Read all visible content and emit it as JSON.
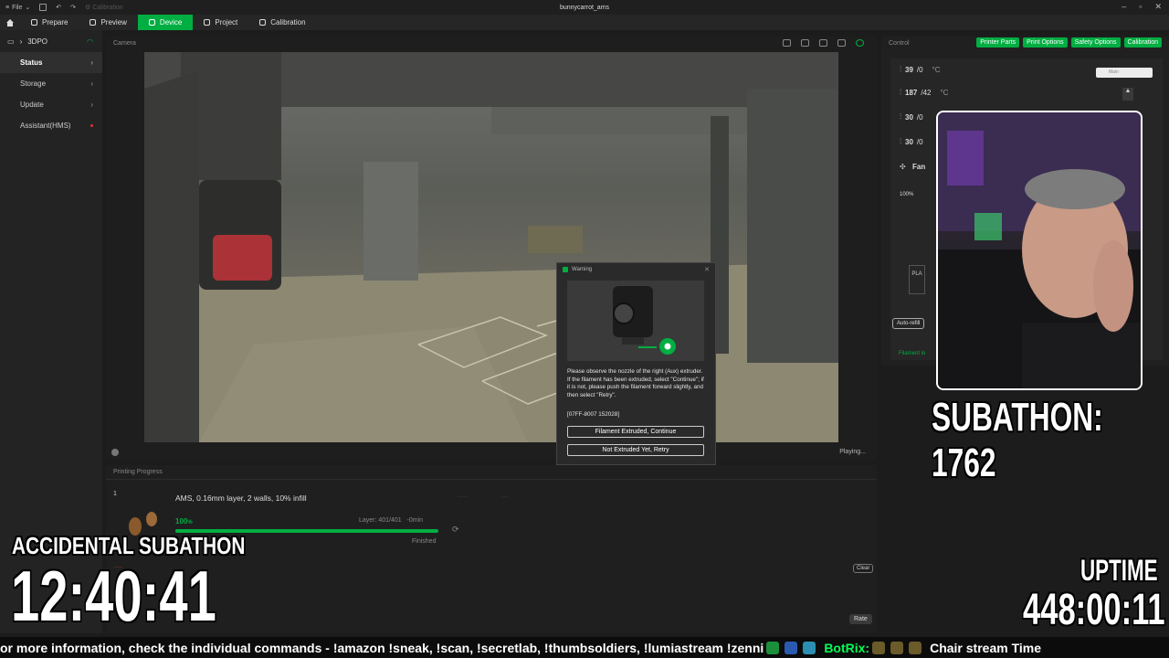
{
  "window": {
    "menu_file": "File",
    "breadcrumb_faint": "Calibration",
    "title": "bunnycarrot_ams"
  },
  "nav": {
    "tabs": [
      {
        "label": "Prepare"
      },
      {
        "label": "Preview"
      },
      {
        "label": "Device",
        "active": true
      },
      {
        "label": "Project"
      },
      {
        "label": "Calibration"
      }
    ]
  },
  "sidebar": {
    "printer_name": "3DPO",
    "items": [
      {
        "label": "Status",
        "active": true
      },
      {
        "label": "Storage"
      },
      {
        "label": "Update"
      },
      {
        "label": "Assistant(HMS)",
        "alert": true
      }
    ]
  },
  "camera": {
    "header": "Camera",
    "status": "Playing..."
  },
  "control": {
    "header": "Control",
    "buttons": [
      "Printer Parts",
      "Print Options",
      "Safety Options",
      "Calibration"
    ],
    "temps": [
      {
        "current": "39",
        "target": "/0",
        "unit": "°C"
      },
      {
        "current": "187",
        "target": "/42",
        "unit": "°C"
      },
      {
        "current": "30",
        "target": "/0",
        "unit": ""
      },
      {
        "current": "30",
        "target": "/0",
        "unit": ""
      }
    ],
    "fan_label": "Fan",
    "fan_percent": "100%",
    "tab_main": "Main",
    "pla_label": "PLA",
    "auto_refill": "Auto-refill",
    "filament_link": "Filament lo"
  },
  "dialog": {
    "title": "Warning",
    "message": "Please observe the nozzle of the right (Aux) extruder. If the filament has been extruded, select \"Continue\"; if it is not, please push the filament forward slightly, and then select \"Retry\".",
    "code": "[07FF-8007 152028]",
    "btn_continue": "Filament Extruded, Continue",
    "btn_retry": "Not Extruded Yet, Retry"
  },
  "progress": {
    "header": "Printing Progress",
    "index": "1",
    "job_title": "AMS, 0.16mm layer, 2 walls, 10% infill",
    "percent_label": "100",
    "percent_unit": "%",
    "percent_value": 100,
    "layer": "Layer: 401/401",
    "remaining": "-0min",
    "status": "Finished",
    "clear_label": "Clear",
    "rate_label": "Rate",
    "error_text": "......"
  },
  "overlay": {
    "accidental": "ACCIDENTAL SUBATHON",
    "timer": "12:40:41",
    "uptime_label": "UPTIME",
    "uptime_value": "448:00:11",
    "subathon": "SUBATHON: 1762",
    "ticker_text": "or more information, check the individual commands - !amazon !sneak, !scan, !secretlab, !thumbsoldiers, !lumiastream !zenni",
    "ticker_user": "BotRix:",
    "ticker_tail": "Chair stream Time"
  },
  "colors": {
    "accent": "#00ae42",
    "alert": "#d33333"
  }
}
